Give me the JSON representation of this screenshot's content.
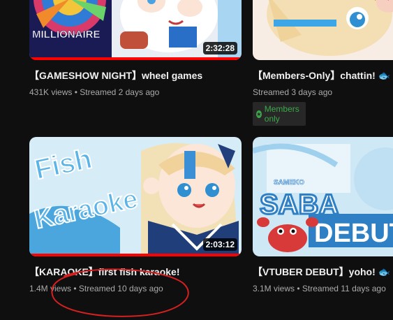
{
  "videos": [
    {
      "title": "【GAMESHOW NIGHT】wheel games",
      "views": "431K views",
      "streamed": "Streamed 2 days ago",
      "duration": "2:32:28",
      "thumb_text": "MILLIONAIRE"
    },
    {
      "title": "【Members-Only】chattin! 🐟",
      "views": "",
      "streamed": "Streamed 3 days ago",
      "badge": "Members only",
      "badge_icon": "star-icon"
    },
    {
      "title": "【KARAOKE】first fish karaoke!",
      "views": "1.4M views",
      "streamed": "Streamed 10 days ago",
      "duration": "2:03:12",
      "thumb_text_1": "Fish",
      "thumb_text_2": "Karaoke"
    },
    {
      "title": "【VTUBER DEBUT】yoho! 🐟 i'm",
      "views": "3.1M views",
      "streamed": "Streamed 11 days ago",
      "thumb_text_1": "SAMEKO",
      "thumb_text_2": "SABA",
      "thumb_text_3": "DEBUT"
    }
  ],
  "colors": {
    "background": "#0f0f0f",
    "progress": "#ff0000",
    "members_green": "#3ea64a",
    "annotation": "#d42020"
  }
}
